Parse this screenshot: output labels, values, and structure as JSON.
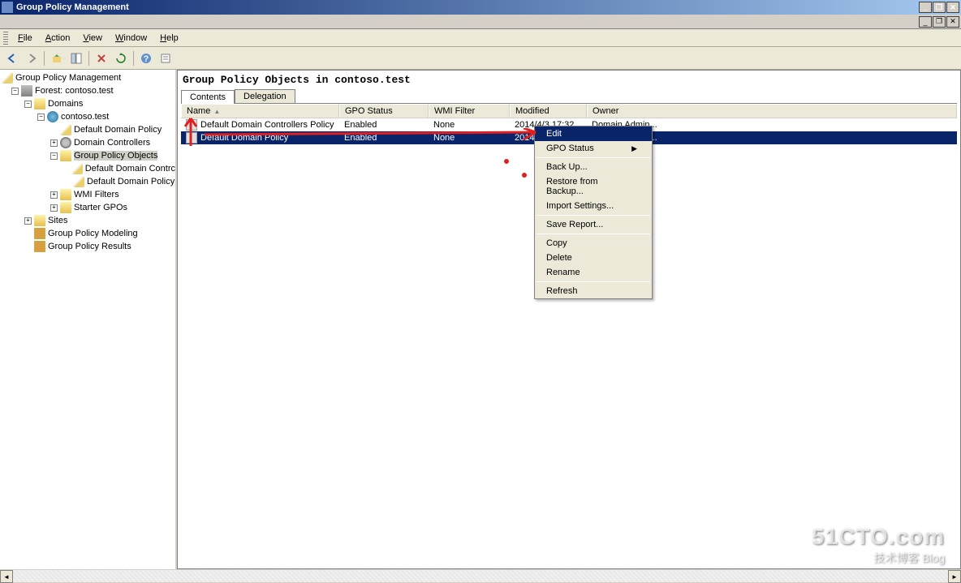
{
  "window": {
    "title": "Group Policy Management"
  },
  "menu": {
    "file": "File",
    "action": "Action",
    "view": "View",
    "window": "Window",
    "help": "Help"
  },
  "tree": {
    "root": "Group Policy Management",
    "forest": "Forest: contoso.test",
    "domains": "Domains",
    "domain": "contoso.test",
    "ddp": "Default Domain Policy",
    "dc": "Domain Controllers",
    "gpo": "Group Policy Objects",
    "ddc": "Default Domain Contrc",
    "ddp2": "Default Domain Policy",
    "wmi": "WMI Filters",
    "starter": "Starter GPOs",
    "sites": "Sites",
    "modeling": "Group Policy Modeling",
    "results": "Group Policy Results"
  },
  "content": {
    "heading": "Group Policy Objects in contoso.test",
    "tabs": {
      "contents": "Contents",
      "delegation": "Delegation"
    },
    "cols": {
      "name": "Name",
      "status": "GPO Status",
      "wmi": "WMI Filter",
      "modified": "Modified",
      "owner": "Owner"
    },
    "rows": [
      {
        "name": "Default Domain Controllers Policy",
        "status": "Enabled",
        "wmi": "None",
        "mod": "2014/4/3 17:32...",
        "owner": "Domain Admin..."
      },
      {
        "name": "Default Domain Policy",
        "status": "Enabled",
        "wmi": "None",
        "mod": "2014/4/4 11:45",
        "owner": "Domain Admin..."
      }
    ]
  },
  "ctx": {
    "edit": "Edit",
    "gpostatus": "GPO Status",
    "backup": "Back Up...",
    "restore": "Restore from Backup...",
    "import": "Import Settings...",
    "savereport": "Save Report...",
    "copy": "Copy",
    "delete": "Delete",
    "rename": "Rename",
    "refresh": "Refresh"
  },
  "watermark": {
    "big": "51CTO.com",
    "small": "技术博客  Blog"
  }
}
